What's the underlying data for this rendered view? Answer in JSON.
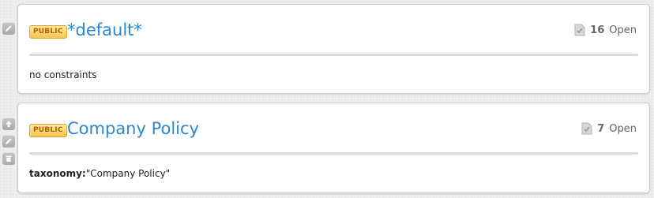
{
  "policies": [
    {
      "badge": "PUBLIC",
      "title": "*default*",
      "open_count": "16",
      "open_label": "Open",
      "constraint_key": "",
      "constraint_value": "no constraints",
      "side_actions": [
        "edit-icon"
      ]
    },
    {
      "badge": "PUBLIC",
      "title": "Company Policy",
      "open_count": "7",
      "open_label": "Open",
      "constraint_key": "taxonomy:",
      "constraint_value": "\"Company Policy\"",
      "side_actions": [
        "arrow-up-icon",
        "edit-icon",
        "trash-icon"
      ]
    }
  ],
  "colors": {
    "title_link": "#2a87d0",
    "badge_bg": "#f6c453",
    "badge_text": "#b35e00"
  }
}
